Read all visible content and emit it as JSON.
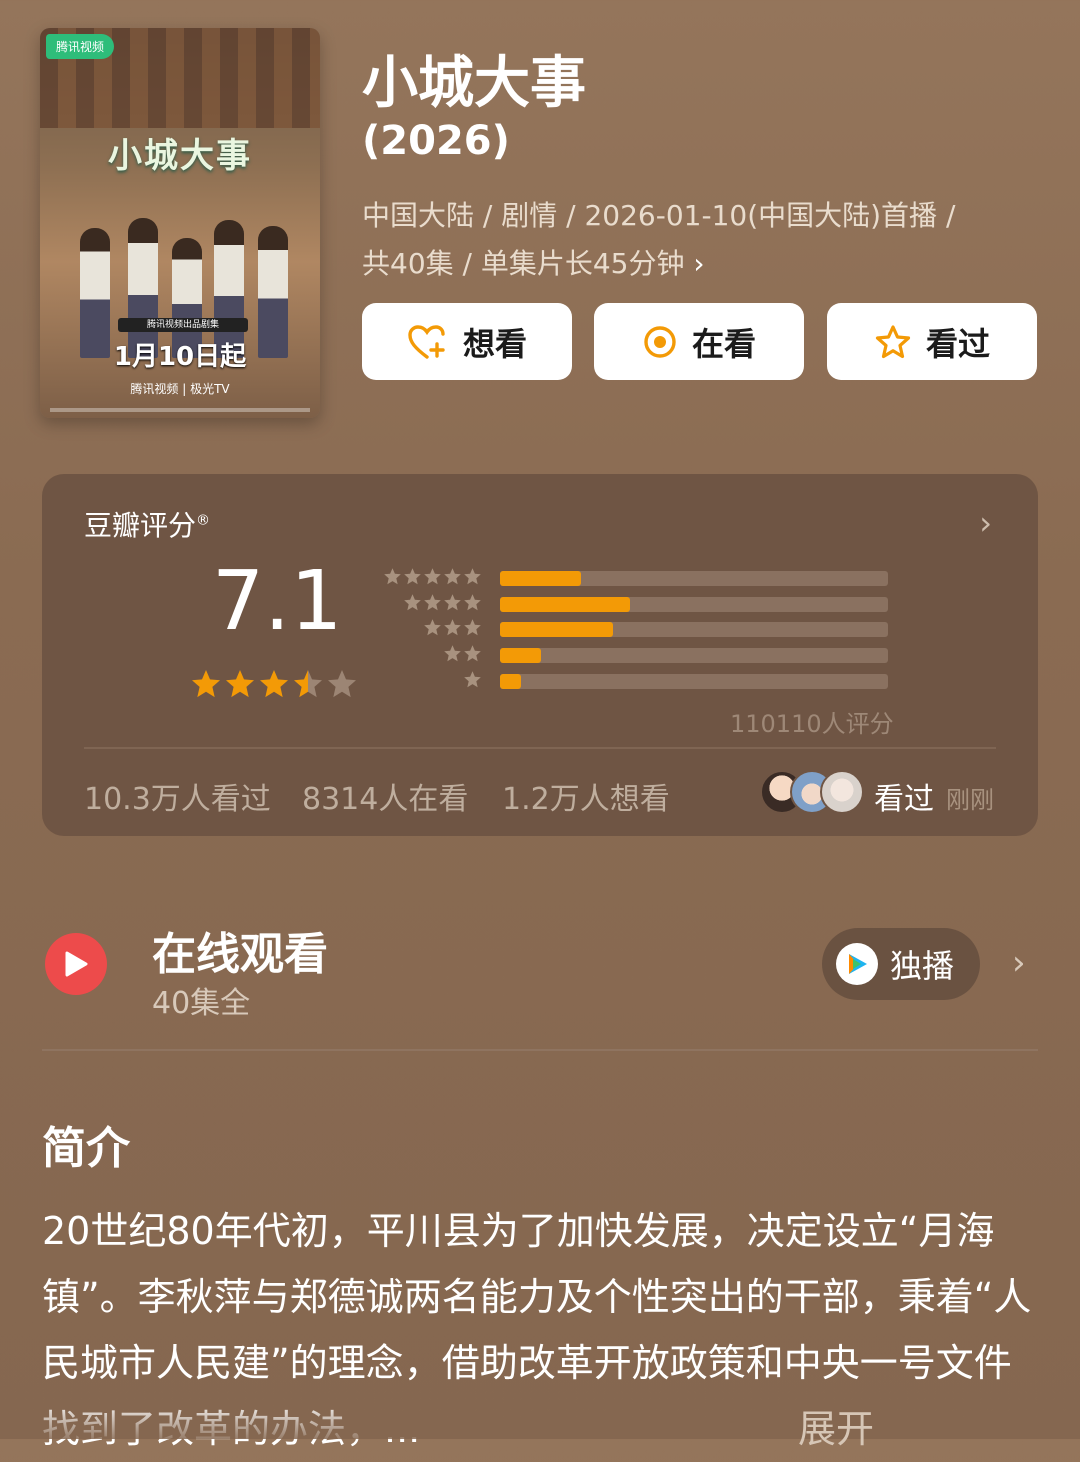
{
  "poster": {
    "badge": "腾讯视频",
    "title": "小城大事",
    "ribbon": "腾讯视频出品剧集",
    "date": "1月10日起",
    "footer": "腾讯视频 | 极光TV"
  },
  "header": {
    "title": "小城大事",
    "year": "(2026)",
    "meta_line1": "中国大陆 / 剧情 / 2026-01-10(中国大陆)首播 /",
    "meta_line2": "共40集 / 单集片长45分钟",
    "meta_chevron": "›"
  },
  "actions": [
    {
      "label": "想看",
      "icon": "heart-plus-icon"
    },
    {
      "label": "在看",
      "icon": "target-icon"
    },
    {
      "label": "看过",
      "icon": "star-outline-icon"
    }
  ],
  "rating": {
    "label": "豆瓣评分",
    "mark": "®",
    "chevron": "›",
    "score": "7.1",
    "stars_value": 3.5,
    "distribution": [
      {
        "stars": 5,
        "fraction": 0.21
      },
      {
        "stars": 4,
        "fraction": 0.335
      },
      {
        "stars": 3,
        "fraction": 0.29
      },
      {
        "stars": 2,
        "fraction": 0.105
      },
      {
        "stars": 1,
        "fraction": 0.055
      }
    ],
    "count": "110110人评分",
    "watched": "10.3万人看过",
    "watching": "8314人在看",
    "want": "1.2万人想看",
    "recent_action": "看过",
    "recent_time": "刚刚"
  },
  "online": {
    "title": "在线观看",
    "episodes": "40集全",
    "exclusive": "独播",
    "chevron": "›"
  },
  "intro": {
    "title": "简介",
    "body": "20世纪80年代初，平川县为了加快发展，决定设立“月海镇”。李秋萍与郑德诚两名能力及个性突出的干部，秉着“人民城市人民建”的理念，借助改革开放政策和中央一号文件找到了改革的办法，...",
    "expand": "展开"
  },
  "colors": {
    "accent_orange": "#f39a06",
    "play_red": "#ed4b4b",
    "bg": "#8a6b52"
  }
}
